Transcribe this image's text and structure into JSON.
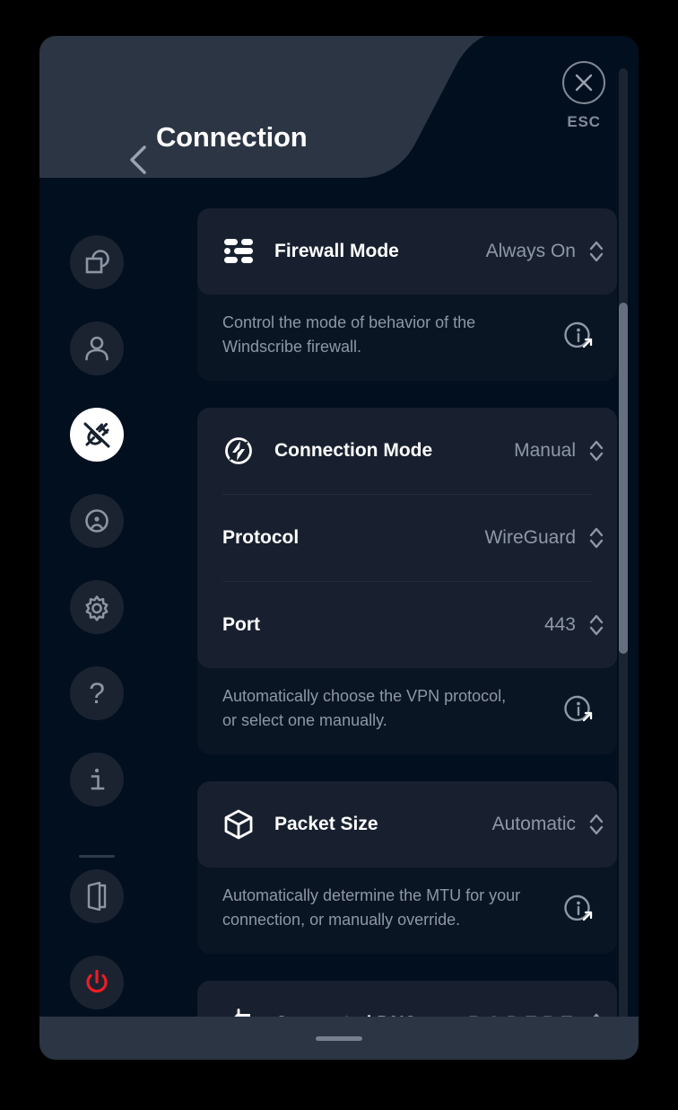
{
  "window": {
    "title": "Connection",
    "back_icon": "chevron-left-icon",
    "close_icon": "close-x-icon",
    "esc_label": "ESC"
  },
  "colors": {
    "background": "#020f1f",
    "header": "#2b3544",
    "card": "#18202f",
    "description_card": "#0a1524",
    "accent_white": "#ffffff",
    "muted_text": "#8e98a6",
    "power_red": "#ed1c24",
    "scrollbar_thumb": "#64707f"
  },
  "sidebar": {
    "items": [
      {
        "name": "general",
        "icon": "shapes-overlap-icon",
        "active": false
      },
      {
        "name": "account",
        "icon": "person-icon",
        "active": false
      },
      {
        "name": "connection",
        "icon": "plug-disconnected-icon",
        "active": true
      },
      {
        "name": "robert",
        "icon": "robert-bot-icon",
        "active": false
      },
      {
        "name": "preferences",
        "icon": "gear-icon",
        "active": false
      },
      {
        "name": "help",
        "icon": "question-mark-icon",
        "active": false
      },
      {
        "name": "about",
        "icon": "info-i-icon",
        "active": false
      },
      {
        "name": "logout",
        "icon": "exit-door-icon",
        "active": false
      },
      {
        "name": "quit",
        "icon": "power-icon",
        "active": false
      }
    ]
  },
  "settings": {
    "groups": [
      {
        "id": "firewall",
        "rows": [
          {
            "id": "firewall-mode",
            "icon": "firewall-bricks-icon",
            "label": "Firewall Mode",
            "value": "Always On",
            "control": "stepper"
          }
        ],
        "description": "Control the mode of behavior of the\nWindscribe firewall.",
        "info_icon": "info-external-link-icon"
      },
      {
        "id": "connection-mode",
        "rows": [
          {
            "id": "connection-mode",
            "icon": "lightning-circle-icon",
            "label": "Connection Mode",
            "value": "Manual",
            "control": "stepper"
          },
          {
            "id": "protocol",
            "icon": null,
            "label": "Protocol",
            "value": "WireGuard",
            "control": "stepper"
          },
          {
            "id": "port",
            "icon": null,
            "label": "Port",
            "value": "443",
            "control": "stepper"
          }
        ],
        "description": "Automatically choose the VPN protocol,\nor select one manually.",
        "info_icon": "info-external-link-icon"
      },
      {
        "id": "packet-size",
        "rows": [
          {
            "id": "packet-size",
            "icon": "package-box-icon",
            "label": "Packet Size",
            "value": "Automatic",
            "control": "stepper"
          }
        ],
        "description": "Automatically determine the MTU for your\nconnection, or manually override.",
        "info_icon": "info-external-link-icon"
      },
      {
        "id": "connected-dns",
        "rows": [
          {
            "id": "connected-dns",
            "icon": "signpost-icon",
            "label": "Connected DNS",
            "value": "R.O.B.E.R.T.",
            "control": "stepper"
          }
        ],
        "description": null,
        "info_icon": null
      }
    ]
  },
  "scrollbar": {
    "thumb_top_pct": 24,
    "thumb_height_pct": 36
  },
  "footer": {
    "handle": "drag-handle"
  }
}
